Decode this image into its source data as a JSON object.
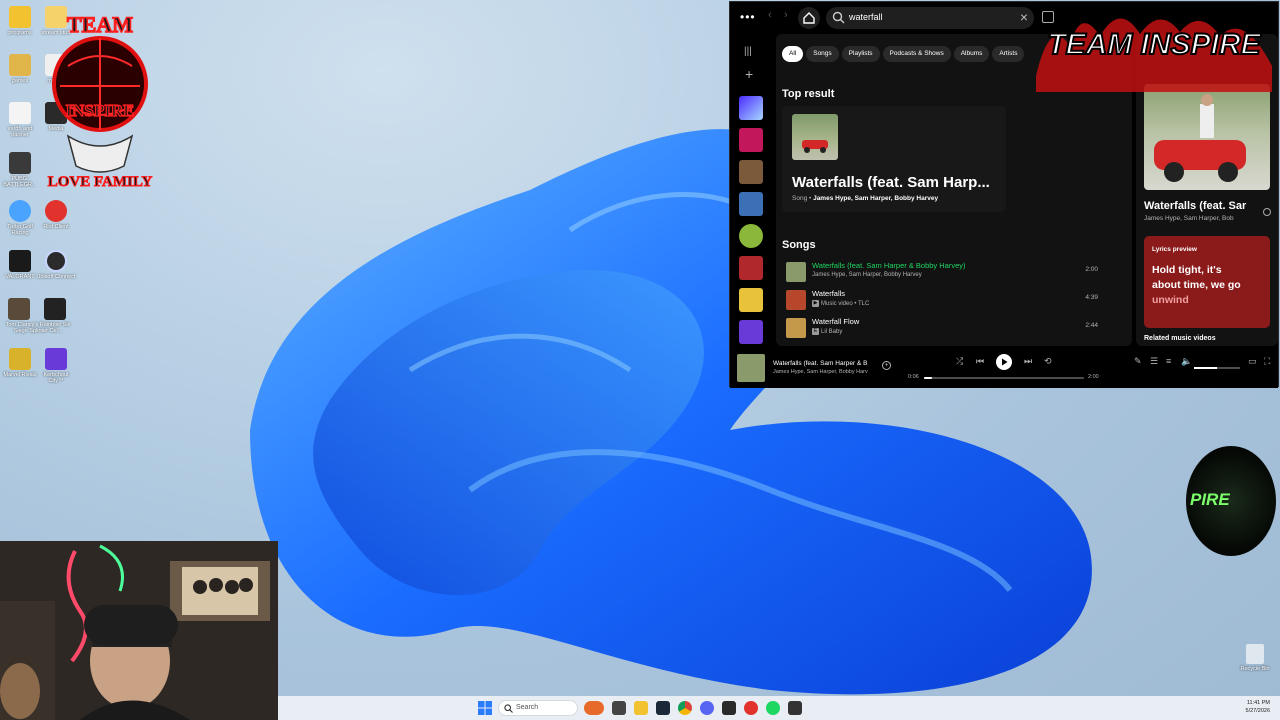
{
  "desktop": {
    "icons": [
      {
        "label": "programs"
      },
      {
        "label": "stream stuff"
      },
      {
        "label": "games"
      },
      {
        "label": "movies"
      },
      {
        "label": "vardh and partner"
      },
      {
        "label": "Media"
      },
      {
        "label": "PUBG: BATTLEGR..."
      },
      {
        "label": "Turbo Golf Racing"
      },
      {
        "label": "Riot Client"
      },
      {
        "label": "VALORANT"
      },
      {
        "label": "Ubisoft Connect"
      },
      {
        "label": "Tom Clancy's Rainbow Six Siege Splinter Cel..."
      },
      {
        "label": "Marvel Rivals"
      },
      {
        "label": "Kerbchout City™"
      }
    ],
    "recycle_bin": "Recycle Bin",
    "team_banner_text": "TEAM INSPIRE",
    "globe_text": "PIRE",
    "logo_text_top": "TEAM",
    "logo_text_mid": "INSPIRE",
    "logo_text_bottom": "LOVE FAMILY"
  },
  "spotify": {
    "search": {
      "value": "waterfall"
    },
    "filters": [
      "All",
      "Songs",
      "Playlists",
      "Podcasts & Shows",
      "Albums",
      "Artists"
    ],
    "active_filter": "All",
    "top_result": {
      "heading": "Top result",
      "title": "Waterfalls (feat. Sam Harp...",
      "type": "Song",
      "artists": "James Hype, Sam Harper, Bobby Harvey"
    },
    "songs": {
      "heading": "Songs",
      "items": [
        {
          "title": "Waterfalls (feat. Sam Harper & Bobby Harvey)",
          "sub": "James Hype, Sam Harper, Bobby Harvey",
          "duration": "2:00",
          "playing": true
        },
        {
          "title": "Waterfalls",
          "badge": "▶",
          "sub": "Music video • TLC",
          "duration": "4:39",
          "playing": false
        },
        {
          "title": "Waterfall Flow",
          "badge": "E",
          "sub": "Lil Baby",
          "duration": "2:44",
          "playing": false
        }
      ]
    },
    "now_playing_panel": {
      "title": "Waterfalls (feat. Sar",
      "artists": "James Hype, Sam Harper, Bob",
      "lyrics_heading": "Lyrics preview",
      "lyrics_line1": "Hold tight, it's",
      "lyrics_line2": "about time, we go",
      "lyrics_line3": "unwind",
      "related_heading": "Related music videos"
    },
    "player": {
      "title": "Waterfalls (feat. Sam Harper & B",
      "artists": "James Hype, Sam Harper, Bobby Harv",
      "elapsed": "0:06",
      "total": "2:00",
      "progress_fraction": 0.05,
      "volume_fraction": 0.5
    },
    "colors": {
      "accent": "#1ed760",
      "lyrics_bg": "#8b1a1a"
    }
  },
  "taskbar": {
    "search_label": "Search",
    "time": "11:41 PM",
    "date": "5/27/2026"
  }
}
